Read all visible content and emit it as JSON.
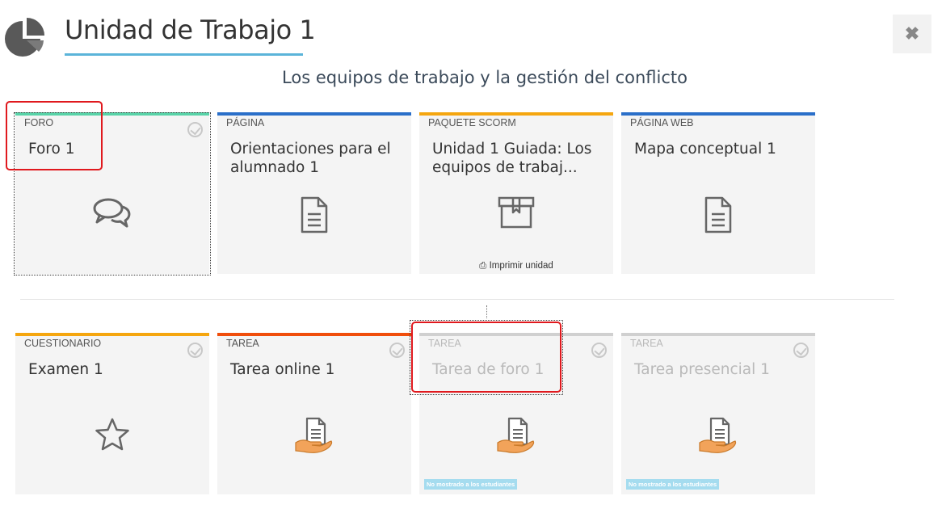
{
  "header": {
    "title": "Unidad de Trabajo 1",
    "subtitle": "Los equipos de trabajo y la gestión del conflicto",
    "close_label": "✖",
    "accent_color": "#5bb4d9"
  },
  "cards": [
    {
      "type": "FORO",
      "title": "Foro 1",
      "bar_color": "#57d3a7",
      "icon": "forum-icon",
      "check": true,
      "dim": false
    },
    {
      "type": "PÁGINA",
      "title": "Orientaciones para el alumnado 1",
      "bar_color": "#2a6fc9",
      "icon": "document-icon",
      "check": false,
      "dim": false
    },
    {
      "type": "PAQUETE SCORM",
      "title": "Unidad 1 Guiada: Los equipos de trabaj...",
      "bar_color": "#f5a60f",
      "icon": "package-icon",
      "check": false,
      "dim": false,
      "print_label": "Imprimir unidad"
    },
    {
      "type": "PÁGINA WEB",
      "title": "Mapa conceptual 1",
      "bar_color": "#2a6fc9",
      "icon": "document-icon",
      "check": false,
      "dim": false
    },
    {
      "type": "CUESTIONARIO",
      "title": "Examen 1",
      "bar_color": "#f5a60f",
      "icon": "star-icon",
      "check": true,
      "dim": false
    },
    {
      "type": "TAREA",
      "title": "Tarea online 1",
      "bar_color": "#f04e0c",
      "icon": "assignment-icon",
      "check": true,
      "dim": false
    },
    {
      "type": "TAREA",
      "title": "Tarea de foro 1",
      "bar_color": "#d0d0d0",
      "icon": "assignment-icon",
      "check": true,
      "dim": true,
      "badge": "No mostrado a los estudiantes"
    },
    {
      "type": "TAREA",
      "title": "Tarea presencial 1",
      "bar_color": "#d0d0d0",
      "icon": "assignment-icon",
      "check": true,
      "dim": true,
      "badge": "No mostrado a los estudiantes"
    }
  ]
}
